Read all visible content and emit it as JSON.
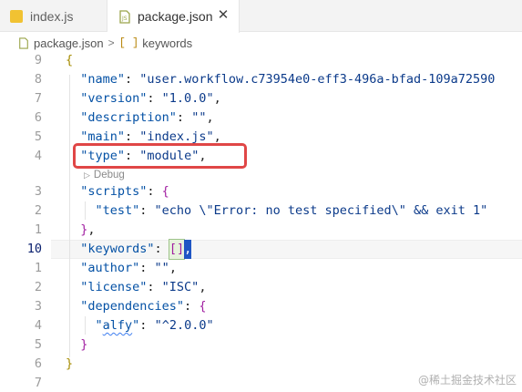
{
  "tabs": [
    {
      "label": "index.js",
      "icon": "js-file-icon",
      "active": false
    },
    {
      "label": "package.json",
      "icon": "json-file-icon",
      "active": true,
      "close": "✕"
    }
  ],
  "breadcrumb": {
    "file": "package.json",
    "separator": ">",
    "symbol_icon": "[ ]",
    "symbol": "keywords"
  },
  "editor": {
    "lines": [
      {
        "num": "9",
        "tokens": [
          {
            "t": "{",
            "c": "brace-y"
          }
        ]
      },
      {
        "num": "8",
        "tokens": [
          {
            "t": "  \"name\"",
            "c": "key"
          },
          {
            "t": ": ",
            "c": "punc"
          },
          {
            "t": "\"user.workflow.c73954e0-eff3-496a-bfad-109a72590",
            "c": "str"
          }
        ]
      },
      {
        "num": "7",
        "tokens": [
          {
            "t": "  \"version\"",
            "c": "key"
          },
          {
            "t": ": ",
            "c": "punc"
          },
          {
            "t": "\"1.0.0\"",
            "c": "str"
          },
          {
            "t": ",",
            "c": "punc"
          }
        ]
      },
      {
        "num": "6",
        "tokens": [
          {
            "t": "  \"description\"",
            "c": "key"
          },
          {
            "t": ": ",
            "c": "punc"
          },
          {
            "t": "\"\"",
            "c": "str"
          },
          {
            "t": ",",
            "c": "punc"
          }
        ]
      },
      {
        "num": "5",
        "tokens": [
          {
            "t": "  \"main\"",
            "c": "key"
          },
          {
            "t": ": ",
            "c": "punc"
          },
          {
            "t": "\"index.js\"",
            "c": "str"
          },
          {
            "t": ",",
            "c": "punc"
          }
        ]
      },
      {
        "num": "4",
        "tokens": [
          {
            "t": "  \"type\"",
            "c": "key"
          },
          {
            "t": ": ",
            "c": "punc"
          },
          {
            "t": "\"module\"",
            "c": "str"
          },
          {
            "t": ",",
            "c": "punc"
          }
        ]
      },
      {
        "num": "3",
        "tokens": [
          {
            "t": "  \"scripts\"",
            "c": "key"
          },
          {
            "t": ": ",
            "c": "punc"
          },
          {
            "t": "{",
            "c": "brace-p"
          }
        ]
      },
      {
        "num": "2",
        "tokens": [
          {
            "t": "    \"test\"",
            "c": "key"
          },
          {
            "t": ": ",
            "c": "punc"
          },
          {
            "t": "\"echo \\\"Error: no test specified\\\" && exit 1\"",
            "c": "str"
          }
        ]
      },
      {
        "num": "1",
        "tokens": [
          {
            "t": "  ",
            "c": "punc"
          },
          {
            "t": "}",
            "c": "brace-p"
          },
          {
            "t": ",",
            "c": "punc"
          }
        ]
      },
      {
        "num": "10",
        "current": true,
        "tokens": [
          {
            "t": "  \"keywords\"",
            "c": "key"
          },
          {
            "t": ": ",
            "c": "punc"
          },
          {
            "t": "[]",
            "c": "brace-p",
            "match": true
          },
          {
            "t": ",",
            "c": "punc",
            "cursor": true
          }
        ]
      },
      {
        "num": "1",
        "tokens": [
          {
            "t": "  \"author\"",
            "c": "key"
          },
          {
            "t": ": ",
            "c": "punc"
          },
          {
            "t": "\"\"",
            "c": "str"
          },
          {
            "t": ",",
            "c": "punc"
          }
        ]
      },
      {
        "num": "2",
        "tokens": [
          {
            "t": "  \"license\"",
            "c": "key"
          },
          {
            "t": ": ",
            "c": "punc"
          },
          {
            "t": "\"ISC\"",
            "c": "str"
          },
          {
            "t": ",",
            "c": "punc"
          }
        ]
      },
      {
        "num": "3",
        "tokens": [
          {
            "t": "  \"dependencies\"",
            "c": "key"
          },
          {
            "t": ": ",
            "c": "punc"
          },
          {
            "t": "{",
            "c": "brace-p"
          }
        ]
      },
      {
        "num": "4",
        "tokens": [
          {
            "t": "    \"",
            "c": "key"
          },
          {
            "t": "alfy",
            "c": "key",
            "squiggle": true
          },
          {
            "t": "\"",
            "c": "key"
          },
          {
            "t": ": ",
            "c": "punc"
          },
          {
            "t": "\"^2.0.0\"",
            "c": "str"
          }
        ]
      },
      {
        "num": "5",
        "tokens": [
          {
            "t": "  ",
            "c": "punc"
          },
          {
            "t": "}",
            "c": "brace-p"
          }
        ]
      },
      {
        "num": "6",
        "tokens": [
          {
            "t": "}",
            "c": "brace-y"
          }
        ]
      },
      {
        "num": "7",
        "tokens": []
      }
    ],
    "codelens_label": "Debug"
  },
  "watermark": "@稀土掘金技术社区",
  "colors": {
    "highlight_box": "#e04646",
    "accent": "#1f56c4"
  }
}
